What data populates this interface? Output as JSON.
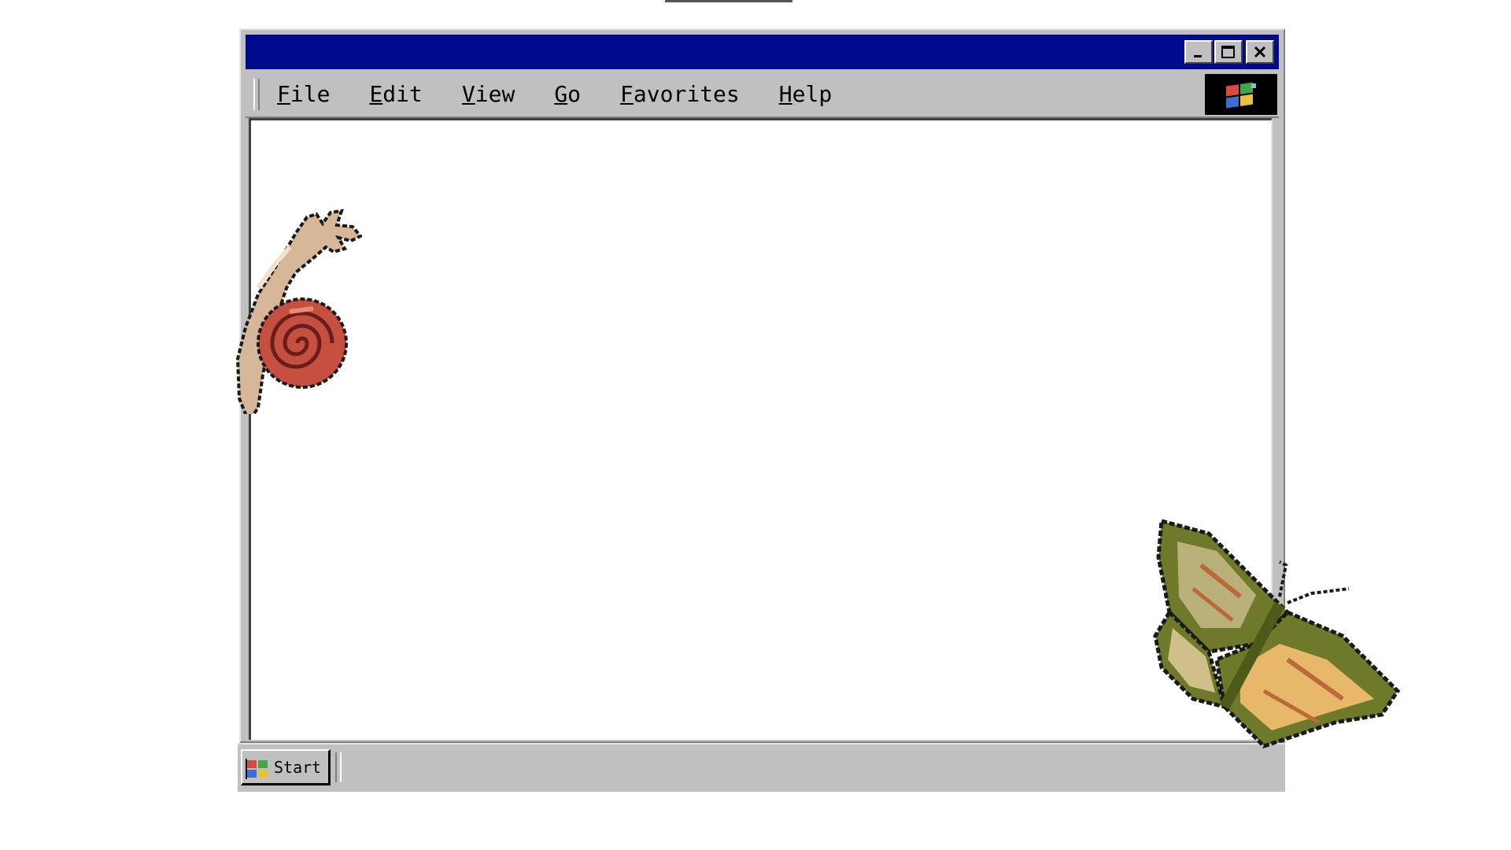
{
  "window": {
    "title": "",
    "controls": {
      "minimize_icon": "minimize-icon",
      "maximize_icon": "maximize-icon",
      "close_icon": "close-icon"
    },
    "title_bar_color": "#000a8c"
  },
  "menu": {
    "items": [
      {
        "label": "File"
      },
      {
        "label": "Edit"
      },
      {
        "label": "View"
      },
      {
        "label": "Go"
      },
      {
        "label": "Favorites"
      },
      {
        "label": "Help"
      }
    ],
    "logo_icon": "windows-logo-icon"
  },
  "taskbar": {
    "start_label": "Start",
    "start_icon": "windows-flag-icon"
  },
  "decorations": {
    "snail_icon": "snail-icon",
    "butterfly_icon": "butterfly-icon"
  }
}
